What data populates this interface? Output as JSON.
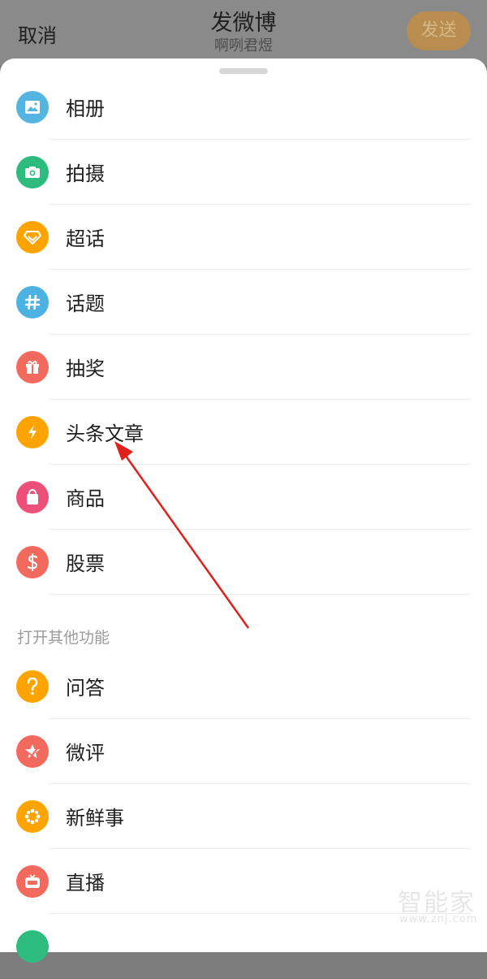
{
  "header": {
    "cancel_label": "取消",
    "title": "发微博",
    "subtitle": "啊咧君煜",
    "send_label": "发送"
  },
  "menu": {
    "items": [
      {
        "label": "相册",
        "icon": "photo-icon",
        "color": "#55b5e2"
      },
      {
        "label": "拍摄",
        "icon": "camera-icon",
        "color": "#2dbc7e"
      },
      {
        "label": "超话",
        "icon": "diamond-icon",
        "color": "#ffa300"
      },
      {
        "label": "话题",
        "icon": "hashtag-icon",
        "color": "#4cb2e2"
      },
      {
        "label": "抽奖",
        "icon": "gift-icon",
        "color": "#f26a5e"
      },
      {
        "label": "头条文章",
        "icon": "lightning-icon",
        "color": "#ffa300"
      },
      {
        "label": "商品",
        "icon": "shopping-bag-icon",
        "color": "#ec4f7a"
      },
      {
        "label": "股票",
        "icon": "dollar-icon",
        "color": "#f26a5e"
      }
    ],
    "section_title": "打开其他功能",
    "more_items": [
      {
        "label": "问答",
        "icon": "question-icon",
        "color": "#ffa300"
      },
      {
        "label": "微评",
        "icon": "star-check-icon",
        "color": "#f26a5e"
      },
      {
        "label": "新鲜事",
        "icon": "sparkle-flower-icon",
        "color": "#ffa300"
      },
      {
        "label": "直播",
        "icon": "live-tv-icon",
        "color": "#f26a5e"
      }
    ]
  },
  "watermark": {
    "brand": "智能家",
    "url": "www.znj.com"
  }
}
